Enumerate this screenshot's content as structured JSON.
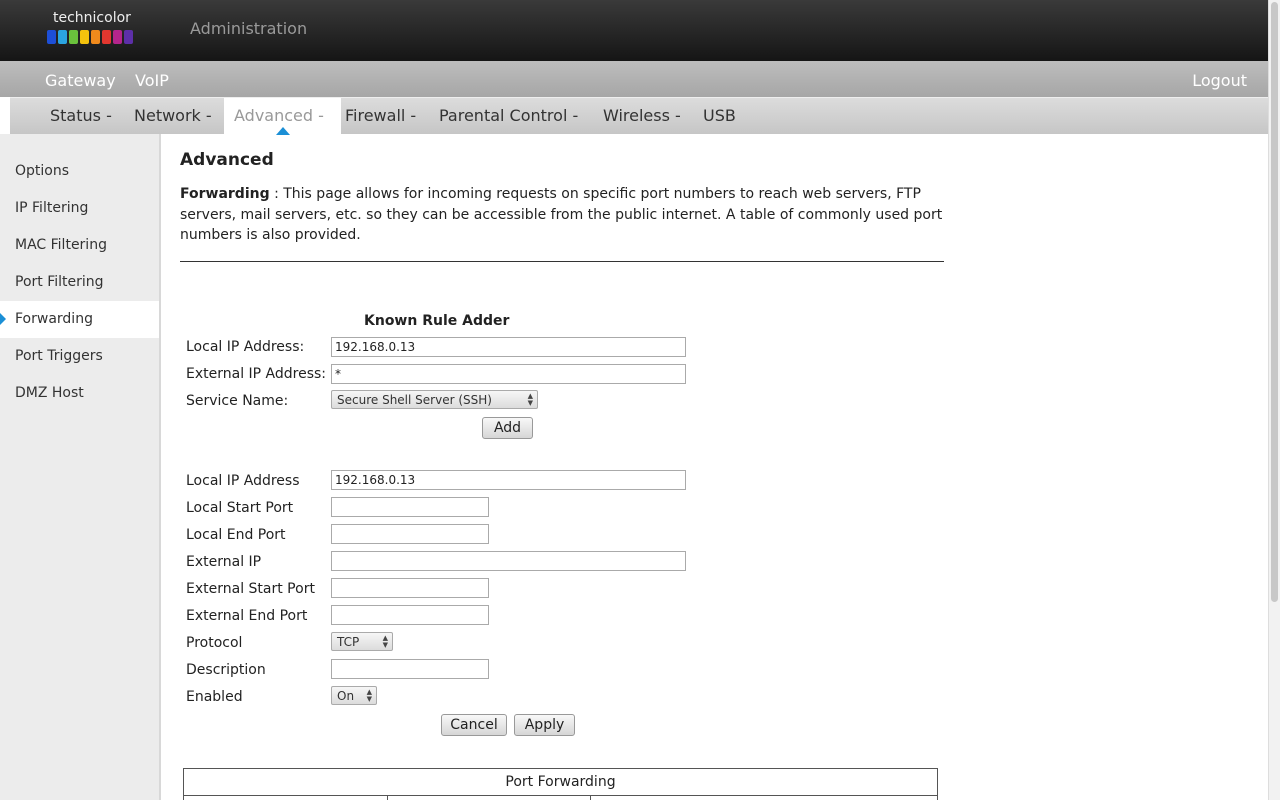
{
  "header": {
    "logo_text": "technicolor",
    "logo_colors": [
      "#1d4fd8",
      "#2ba4e0",
      "#6ac23c",
      "#f4c20d",
      "#f08a1c",
      "#e2372f",
      "#b4258c",
      "#5d2fa8"
    ],
    "admin_title": "Administration"
  },
  "main_nav": {
    "items": [
      "Gateway",
      "VoIP"
    ],
    "logout": "Logout"
  },
  "sub_nav": {
    "items": [
      "Status -",
      "Network -",
      "Advanced -",
      "Firewall -",
      "Parental Control -",
      "Wireless -",
      "USB"
    ],
    "active": "Advanced -",
    "accent": "#1b8fd6"
  },
  "sidebar": {
    "items": [
      "Options",
      "IP Filtering",
      "MAC Filtering",
      "Port Filtering",
      "Forwarding",
      "Port Triggers",
      "DMZ Host"
    ],
    "active": "Forwarding"
  },
  "page": {
    "title": "Advanced",
    "desc_bold": "Forwarding",
    "desc_text": "  :  This page allows for incoming requests on specific port numbers to reach web servers, FTP servers, mail servers, etc. so they can be accessible from the public internet. A table of commonly used port numbers is also provided."
  },
  "known_rule_adder": {
    "title": "Known Rule Adder",
    "local_ip_label": "Local IP Address:",
    "local_ip_value": "192.168.0.13",
    "external_ip_label": "External IP Address:",
    "external_ip_value": "*",
    "service_label": "Service Name:",
    "service_value": "Secure Shell Server (SSH)",
    "add_button": "Add"
  },
  "rule_form": {
    "local_ip_label": "Local IP Address",
    "local_ip_value": "192.168.0.13",
    "local_start_port_label": "Local Start Port",
    "local_start_port_value": "",
    "local_end_port_label": "Local End Port",
    "local_end_port_value": "",
    "external_ip_label": "External IP",
    "external_ip_value": "",
    "external_start_port_label": "External Start Port",
    "external_start_port_value": "",
    "external_end_port_label": "External End Port",
    "external_end_port_value": "",
    "protocol_label": "Protocol",
    "protocol_value": "TCP",
    "description_label": "Description",
    "description_value": "",
    "enabled_label": "Enabled",
    "enabled_value": "On",
    "cancel_button": "Cancel",
    "apply_button": "Apply"
  },
  "port_forwarding_table": {
    "title": "Port Forwarding"
  }
}
